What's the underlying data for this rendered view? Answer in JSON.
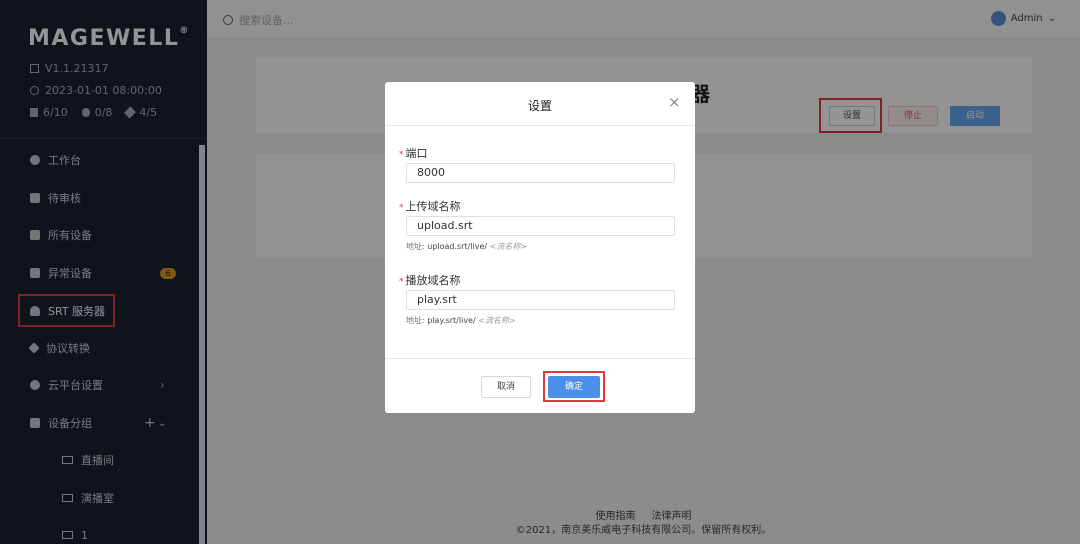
{
  "sidebar": {
    "logo": "MAGEWELL",
    "version": "V1.1.21317",
    "datetime": "2023-01-01 08:00:00",
    "stats": [
      "6/10",
      "0/8",
      "4/5"
    ],
    "items": [
      {
        "label": "工作台"
      },
      {
        "label": "待审核"
      },
      {
        "label": "所有设备"
      },
      {
        "label": "异常设备",
        "badge": "6"
      },
      {
        "label": "SRT 服务器"
      },
      {
        "label": "协议转换"
      },
      {
        "label": "云平台设置",
        "chevron": "›"
      },
      {
        "label": "设备分组",
        "plus": "+",
        "chevron_down": "⌄"
      }
    ],
    "groups": [
      "直播间",
      "演播室",
      "1"
    ]
  },
  "topbar": {
    "search_placeholder": "搜索设备...",
    "user": "Admin"
  },
  "main": {
    "title_peek": "器",
    "buttons": {
      "settings": "设置",
      "stop": "停止",
      "start": "启动"
    }
  },
  "footer": {
    "links": [
      "使用指南",
      "法律声明"
    ],
    "copyright": "©2021，南京美乐威电子科技有限公司。保留所有权利。"
  },
  "modal": {
    "title": "设置",
    "fields": [
      {
        "label": "端口",
        "value": "8000"
      },
      {
        "label": "上传域名称",
        "value": "upload.srt",
        "hint_prefix": "地址: ",
        "hint_value": "upload.srt/live/",
        "hint_placeholder": "<流名称>"
      },
      {
        "label": "播放域名称",
        "value": "play.srt",
        "hint_prefix": "地址: ",
        "hint_value": "play.srt/live/",
        "hint_placeholder": "<流名称>"
      }
    ],
    "required_mark": "*",
    "cancel": "取消",
    "confirm": "确定",
    "close": "×"
  },
  "colors": {
    "sidebar_bg": "#1a2230",
    "primary": "#4a90e8",
    "highlight": "#e0393b",
    "badge": "#d89a22"
  }
}
